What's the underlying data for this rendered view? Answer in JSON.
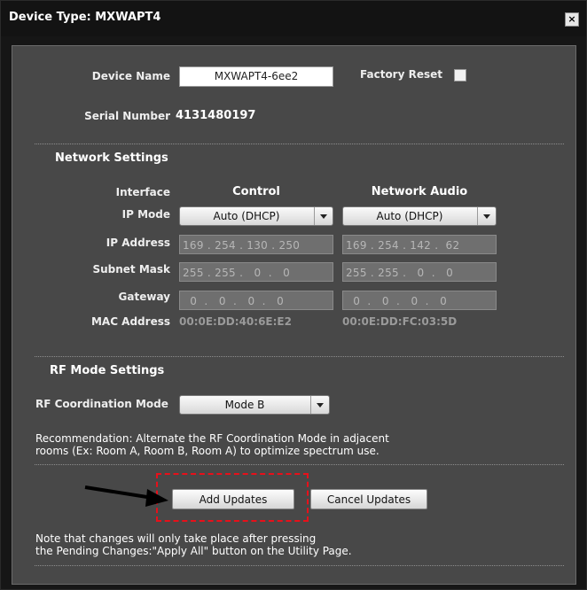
{
  "window": {
    "title": "Device Type: MXWAPT4",
    "close_glyph": "×"
  },
  "device": {
    "name_label": "Device Name",
    "name_value": "MXWAPT4-6ee2",
    "factory_reset_label": "Factory Reset",
    "factory_reset_checked": false,
    "serial_label": "Serial Number",
    "serial_value": "4131480197"
  },
  "network": {
    "header": "Network Settings",
    "interface_label": "Interface",
    "col_control": "Control",
    "col_audio": "Network Audio",
    "ip_mode_label": "IP Mode",
    "ip_mode_control": "Auto (DHCP)",
    "ip_mode_audio": "Auto (DHCP)",
    "ip_address_label": "IP Address",
    "ip_address_control": "169 . 254 . 130 . 250",
    "ip_address_audio": "169 . 254 . 142 .  62",
    "subnet_label": "Subnet Mask",
    "subnet_control": "255 . 255 .   0  .   0",
    "subnet_audio": "255 . 255 .   0  .   0",
    "gateway_label": "Gateway",
    "gateway_control": "  0  .   0  .   0  .   0",
    "gateway_audio": "  0  .   0  .   0  .   0",
    "mac_label": "MAC Address",
    "mac_control": "00:0E:DD:40:6E:E2",
    "mac_audio": "00:0E:DD:FC:03:5D"
  },
  "rf": {
    "header": "RF Mode Settings",
    "coord_label": "RF Coordination Mode",
    "coord_value": "Mode B",
    "recommendation_line1": "Recommendation: Alternate the RF Coordination Mode in adjacent",
    "recommendation_line2": "rooms (Ex: Room A, Room B, Room A) to optimize spectrum use."
  },
  "actions": {
    "add_updates": "Add Updates",
    "cancel_updates": "Cancel Updates",
    "note_line1": "Note that changes will only take place after pressing",
    "note_line2": "the Pending Changes:\"Apply All\" button on the Utility Page."
  },
  "colors": {
    "dialog_bg": "#161616",
    "panel_bg": "#484848",
    "highlight": "#e8101a",
    "arrow": "#000000"
  }
}
